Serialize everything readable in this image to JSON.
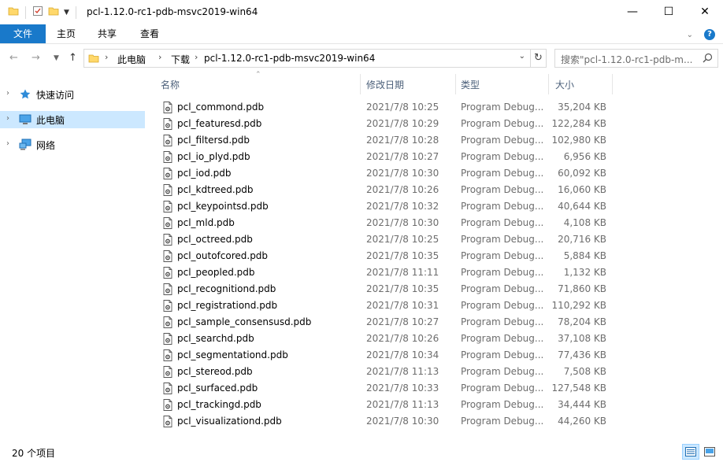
{
  "window": {
    "title": "pcl-1.12.0-rc1-pdb-msvc2019-win64",
    "minimize": "—",
    "maximize": "☐",
    "close": "✕"
  },
  "ribbon": {
    "tabs": [
      {
        "label": "文件"
      },
      {
        "label": "主页"
      },
      {
        "label": "共享"
      },
      {
        "label": "查看"
      }
    ]
  },
  "address": {
    "crumbs": [
      "此电脑",
      "下载",
      "pcl-1.12.0-rc1-pdb-msvc2019-win64"
    ],
    "search_placeholder": "搜索\"pcl-1.12.0-rc1-pdb-m..."
  },
  "nav": {
    "items": [
      {
        "label": "快速访问",
        "icon": "star-icon"
      },
      {
        "label": "此电脑",
        "icon": "computer-icon"
      },
      {
        "label": "网络",
        "icon": "network-icon"
      }
    ]
  },
  "columns": {
    "name": "名称",
    "date": "修改日期",
    "type": "类型",
    "size": "大小"
  },
  "files": [
    {
      "name": "pcl_commond.pdb",
      "date": "2021/7/8 10:25",
      "type": "Program Debug...",
      "size": "35,204 KB"
    },
    {
      "name": "pcl_featuresd.pdb",
      "date": "2021/7/8 10:29",
      "type": "Program Debug...",
      "size": "122,284 KB"
    },
    {
      "name": "pcl_filtersd.pdb",
      "date": "2021/7/8 10:28",
      "type": "Program Debug...",
      "size": "102,980 KB"
    },
    {
      "name": "pcl_io_plyd.pdb",
      "date": "2021/7/8 10:27",
      "type": "Program Debug...",
      "size": "6,956 KB"
    },
    {
      "name": "pcl_iod.pdb",
      "date": "2021/7/8 10:30",
      "type": "Program Debug...",
      "size": "60,092 KB"
    },
    {
      "name": "pcl_kdtreed.pdb",
      "date": "2021/7/8 10:26",
      "type": "Program Debug...",
      "size": "16,060 KB"
    },
    {
      "name": "pcl_keypointsd.pdb",
      "date": "2021/7/8 10:32",
      "type": "Program Debug...",
      "size": "40,644 KB"
    },
    {
      "name": "pcl_mld.pdb",
      "date": "2021/7/8 10:30",
      "type": "Program Debug...",
      "size": "4,108 KB"
    },
    {
      "name": "pcl_octreed.pdb",
      "date": "2021/7/8 10:25",
      "type": "Program Debug...",
      "size": "20,716 KB"
    },
    {
      "name": "pcl_outofcored.pdb",
      "date": "2021/7/8 10:35",
      "type": "Program Debug...",
      "size": "5,884 KB"
    },
    {
      "name": "pcl_peopled.pdb",
      "date": "2021/7/8 11:11",
      "type": "Program Debug...",
      "size": "1,132 KB"
    },
    {
      "name": "pcl_recognitiond.pdb",
      "date": "2021/7/8 10:35",
      "type": "Program Debug...",
      "size": "71,860 KB"
    },
    {
      "name": "pcl_registrationd.pdb",
      "date": "2021/7/8 10:31",
      "type": "Program Debug...",
      "size": "110,292 KB"
    },
    {
      "name": "pcl_sample_consensusd.pdb",
      "date": "2021/7/8 10:27",
      "type": "Program Debug...",
      "size": "78,204 KB"
    },
    {
      "name": "pcl_searchd.pdb",
      "date": "2021/7/8 10:26",
      "type": "Program Debug...",
      "size": "37,108 KB"
    },
    {
      "name": "pcl_segmentationd.pdb",
      "date": "2021/7/8 10:34",
      "type": "Program Debug...",
      "size": "77,436 KB"
    },
    {
      "name": "pcl_stereod.pdb",
      "date": "2021/7/8 11:13",
      "type": "Program Debug...",
      "size": "7,508 KB"
    },
    {
      "name": "pcl_surfaced.pdb",
      "date": "2021/7/8 10:33",
      "type": "Program Debug...",
      "size": "127,548 KB"
    },
    {
      "name": "pcl_trackingd.pdb",
      "date": "2021/7/8 11:13",
      "type": "Program Debug...",
      "size": "34,444 KB"
    },
    {
      "name": "pcl_visualizationd.pdb",
      "date": "2021/7/8 10:30",
      "type": "Program Debug...",
      "size": "44,260 KB"
    }
  ],
  "status": {
    "count": "20 个项目"
  },
  "colors": {
    "accent": "#1979ca",
    "selection": "#cce8ff",
    "folder": "#ffd86b"
  }
}
